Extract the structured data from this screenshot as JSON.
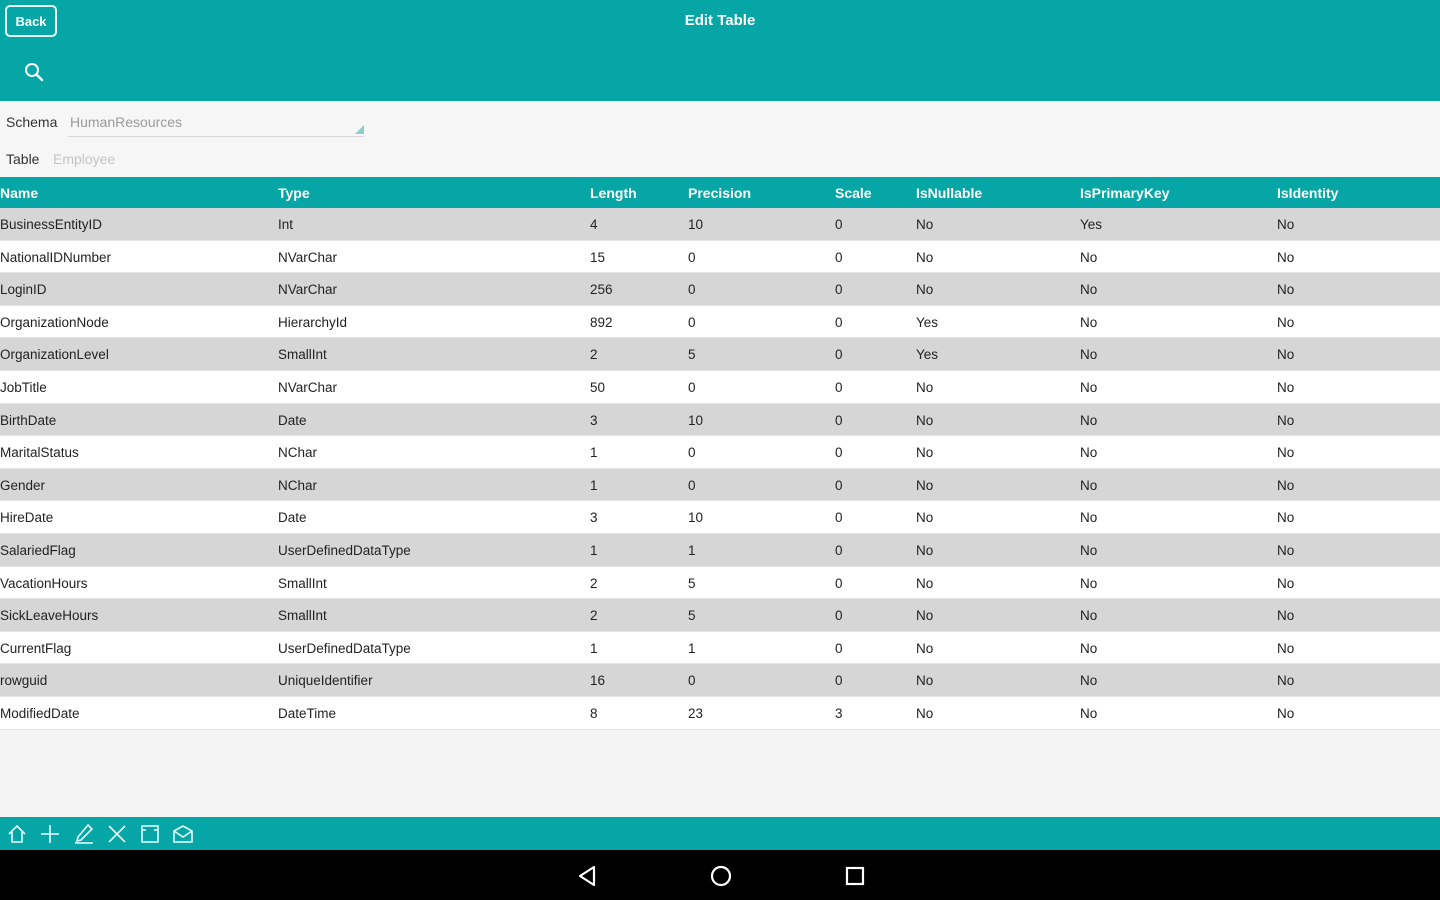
{
  "header": {
    "back_label": "Back",
    "title": "Edit Table",
    "search_icon": "search-icon",
    "color": "#06a5a6"
  },
  "filters": {
    "schema_label": "Schema",
    "schema_value": "HumanResources",
    "table_label": "Table",
    "table_value": "Employee"
  },
  "grid": {
    "columns": [
      "Name",
      "Type",
      "Length",
      "Precision",
      "Scale",
      "IsNullable",
      "IsPrimaryKey",
      "IsIdentity"
    ],
    "rows": [
      [
        "BusinessEntityID",
        "Int",
        "4",
        "10",
        "0",
        "No",
        "Yes",
        "No"
      ],
      [
        "NationalIDNumber",
        "NVarChar",
        "15",
        "0",
        "0",
        "No",
        "No",
        "No"
      ],
      [
        "LoginID",
        "NVarChar",
        "256",
        "0",
        "0",
        "No",
        "No",
        "No"
      ],
      [
        "OrganizationNode",
        "HierarchyId",
        "892",
        "0",
        "0",
        "Yes",
        "No",
        "No"
      ],
      [
        "OrganizationLevel",
        "SmallInt",
        "2",
        "5",
        "0",
        "Yes",
        "No",
        "No"
      ],
      [
        "JobTitle",
        "NVarChar",
        "50",
        "0",
        "0",
        "No",
        "No",
        "No"
      ],
      [
        "BirthDate",
        "Date",
        "3",
        "10",
        "0",
        "No",
        "No",
        "No"
      ],
      [
        "MaritalStatus",
        "NChar",
        "1",
        "0",
        "0",
        "No",
        "No",
        "No"
      ],
      [
        "Gender",
        "NChar",
        "1",
        "0",
        "0",
        "No",
        "No",
        "No"
      ],
      [
        "HireDate",
        "Date",
        "3",
        "10",
        "0",
        "No",
        "No",
        "No"
      ],
      [
        "SalariedFlag",
        "UserDefinedDataType",
        "1",
        "1",
        "0",
        "No",
        "No",
        "No"
      ],
      [
        "VacationHours",
        "SmallInt",
        "2",
        "5",
        "0",
        "No",
        "No",
        "No"
      ],
      [
        "SickLeaveHours",
        "SmallInt",
        "2",
        "5",
        "0",
        "No",
        "No",
        "No"
      ],
      [
        "CurrentFlag",
        "UserDefinedDataType",
        "1",
        "1",
        "0",
        "No",
        "No",
        "No"
      ],
      [
        "rowguid",
        "UniqueIdentifier",
        "16",
        "0",
        "0",
        "No",
        "No",
        "No"
      ],
      [
        "ModifiedDate",
        "DateTime",
        "8",
        "23",
        "3",
        "No",
        "No",
        "No"
      ]
    ]
  },
  "toolbar": {
    "icons": [
      "home-icon",
      "plus-icon",
      "edit-icon",
      "close-icon",
      "clipboard-icon",
      "mail-icon"
    ]
  },
  "navbar": {
    "icons": [
      "back-triangle-icon",
      "home-circle-icon",
      "recents-square-icon"
    ]
  }
}
